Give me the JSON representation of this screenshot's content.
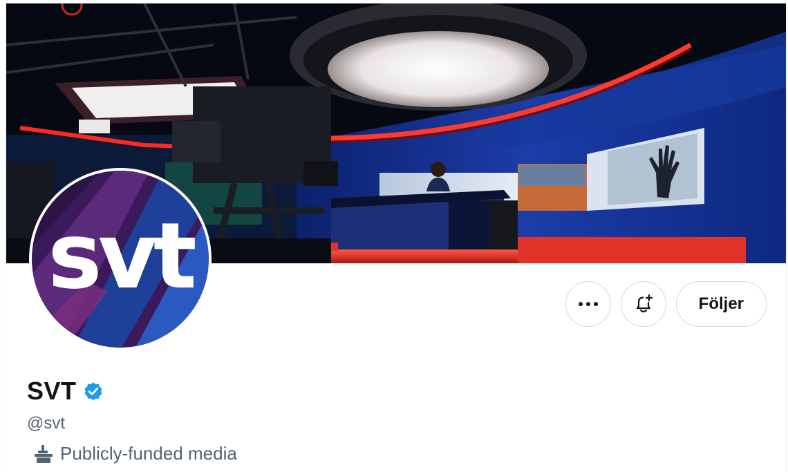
{
  "profile": {
    "display_name": "SVT",
    "handle": "@svt",
    "verified": true,
    "verified_badge_color": "#1d9bf0",
    "affiliation_icon": "government-building-icon",
    "affiliation_label": "Publicly-funded media",
    "avatar_logo_text": "svt"
  },
  "actions": {
    "more_icon": "more-options-icon",
    "notify_icon": "bell-plus-icon",
    "follow_label": "Följer"
  },
  "banner": {
    "description_icon": "newsroom-studio-photo"
  },
  "colors": {
    "text_primary": "#0f1419",
    "text_secondary": "#536471",
    "border": "#cfd9de",
    "avatar_purple": "#3b1a5c",
    "avatar_blue": "#1e3f9a",
    "studio_red": "#ff3b2f"
  }
}
